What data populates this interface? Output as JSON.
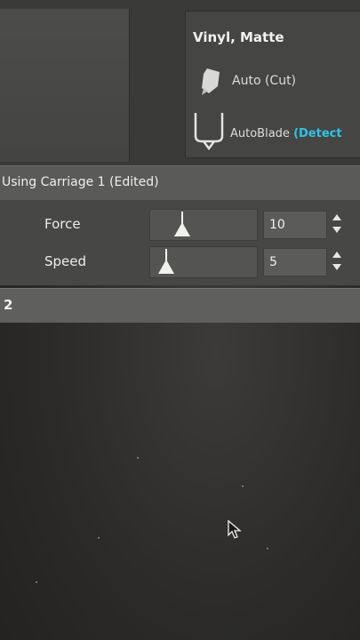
{
  "material": {
    "name": "Vinyl, Matte",
    "tool_mode": "Auto (Cut)",
    "tool_name": "AutoBlade",
    "tool_status": "(Detect",
    "status_color": "#2fc4e6"
  },
  "carriage": {
    "title": "Using Carriage 1 (Edited)"
  },
  "settings": {
    "force": {
      "label": "Force",
      "value": "10",
      "level": 0.3
    },
    "speed": {
      "label": "Speed",
      "value": "5",
      "level": 0.15
    }
  },
  "section": {
    "number": "2"
  },
  "icons": {
    "auto": "blade-tool-icon",
    "autoblade": "autoblade-holder-icon",
    "cursor": "mouse-pointer-icon"
  }
}
